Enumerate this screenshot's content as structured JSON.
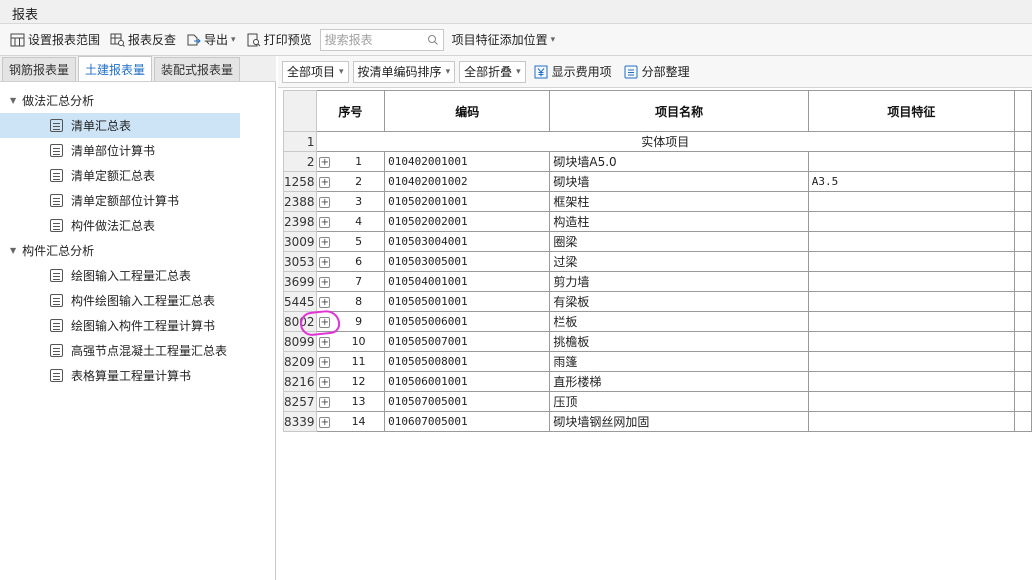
{
  "window": {
    "title": "报表"
  },
  "toolbar": {
    "set_range": "设置报表范围",
    "reverse_check": "报表反查",
    "export": "导出",
    "print_preview": "打印预览",
    "search_placeholder": "搜索报表",
    "feature_position": "项目特征添加位置"
  },
  "left_tabs": [
    "钢筋报表量",
    "土建报表量",
    "装配式报表量"
  ],
  "tree": {
    "group1": "做法汇总分析",
    "group1_items": [
      "清单汇总表",
      "清单部位计算书",
      "清单定额汇总表",
      "清单定额部位计算书",
      "构件做法汇总表"
    ],
    "group2": "构件汇总分析",
    "group2_items": [
      "绘图输入工程量汇总表",
      "构件绘图输入工程量汇总表",
      "绘图输入构件工程量计算书",
      "高强节点混凝土工程量汇总表",
      "表格算量工程量计算书"
    ]
  },
  "right_toolbar": {
    "all_items": "全部项目",
    "sort": "按清单编码排序",
    "collapse": "全部折叠",
    "show_fee": "显示费用项",
    "section_arrange": "分部整理"
  },
  "grid": {
    "headers": {
      "seq": "序号",
      "code": "编码",
      "name": "项目名称",
      "feature": "项目特征"
    },
    "group_row": {
      "rowhead": "1",
      "label": "实体项目"
    },
    "rows": [
      {
        "rowhead": "2",
        "seq": "1",
        "code": "010402001001",
        "name": "砌块墙A5.0",
        "feature": ""
      },
      {
        "rowhead": "1258",
        "seq": "2",
        "code": "010402001002",
        "name": "砌块墙",
        "feature": "A3.5"
      },
      {
        "rowhead": "2388",
        "seq": "3",
        "code": "010502001001",
        "name": "框架柱",
        "feature": ""
      },
      {
        "rowhead": "2398",
        "seq": "4",
        "code": "010502002001",
        "name": "构造柱",
        "feature": ""
      },
      {
        "rowhead": "3009",
        "seq": "5",
        "code": "010503004001",
        "name": "圈梁",
        "feature": ""
      },
      {
        "rowhead": "3053",
        "seq": "6",
        "code": "010503005001",
        "name": "过梁",
        "feature": ""
      },
      {
        "rowhead": "3699",
        "seq": "7",
        "code": "010504001001",
        "name": "剪力墙",
        "feature": ""
      },
      {
        "rowhead": "5445",
        "seq": "8",
        "code": "010505001001",
        "name": "有梁板",
        "feature": ""
      },
      {
        "rowhead": "8002",
        "seq": "9",
        "code": "010505006001",
        "name": "栏板",
        "feature": ""
      },
      {
        "rowhead": "8099",
        "seq": "10",
        "code": "010505007001",
        "name": "挑檐板",
        "feature": ""
      },
      {
        "rowhead": "8209",
        "seq": "11",
        "code": "010505008001",
        "name": "雨篷",
        "feature": ""
      },
      {
        "rowhead": "8216",
        "seq": "12",
        "code": "010506001001",
        "name": "直形楼梯",
        "feature": ""
      },
      {
        "rowhead": "8257",
        "seq": "13",
        "code": "010507005001",
        "name": "压顶",
        "feature": ""
      },
      {
        "rowhead": "8339",
        "seq": "14",
        "code": "010607005001",
        "name": "砌块墙钢丝网加固",
        "feature": ""
      }
    ]
  },
  "colors": {
    "accent": "#1f6fc8",
    "selection": "#cde4f7",
    "annotation": "#e033d8"
  }
}
